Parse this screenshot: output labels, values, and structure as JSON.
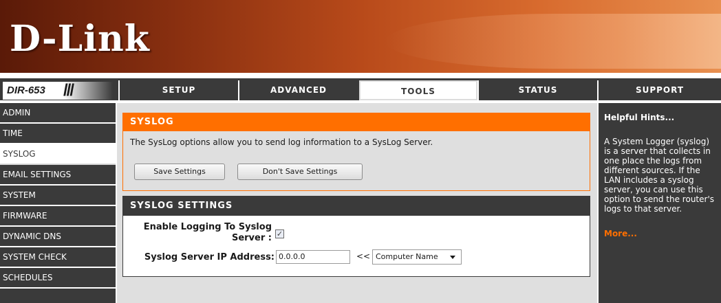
{
  "brand": {
    "logo": "D-Link",
    "model": "DIR-653",
    "slashes": "///"
  },
  "top_tabs": [
    {
      "label": "SETUP"
    },
    {
      "label": "ADVANCED"
    },
    {
      "label": "TOOLS"
    },
    {
      "label": "STATUS"
    },
    {
      "label": "SUPPORT"
    }
  ],
  "sidebar": {
    "items": [
      {
        "label": "ADMIN"
      },
      {
        "label": "TIME"
      },
      {
        "label": "SYSLOG"
      },
      {
        "label": "EMAIL SETTINGS"
      },
      {
        "label": "SYSTEM"
      },
      {
        "label": "FIRMWARE"
      },
      {
        "label": "DYNAMIC DNS"
      },
      {
        "label": "SYSTEM CHECK"
      },
      {
        "label": "SCHEDULES"
      }
    ]
  },
  "syslog": {
    "title": "SYSLOG",
    "description": "The SysLog options allow you to send log information to a SysLog Server.",
    "save_button": "Save Settings",
    "dont_save_button": "Don't Save Settings"
  },
  "settings": {
    "title": "SYSLOG SETTINGS",
    "enable_label_line1": "Enable Logging To Syslog",
    "enable_label_line2": "Server :",
    "enable_checked": true,
    "ip_label": "Syslog Server IP Address:",
    "ip_value": "0.0.0.0",
    "arrows": "<<",
    "computer_select": "Computer Name"
  },
  "hints": {
    "title": "Helpful Hints...",
    "body": "A System Logger (syslog) is a server that collects in one place the logs from different sources. If the LAN includes a syslog server, you can use this option to send the router's logs to that server.",
    "more": "More..."
  },
  "colors": {
    "accent": "#ff6f00",
    "dark": "#3a3a3a",
    "panel": "#dfdfdf"
  }
}
